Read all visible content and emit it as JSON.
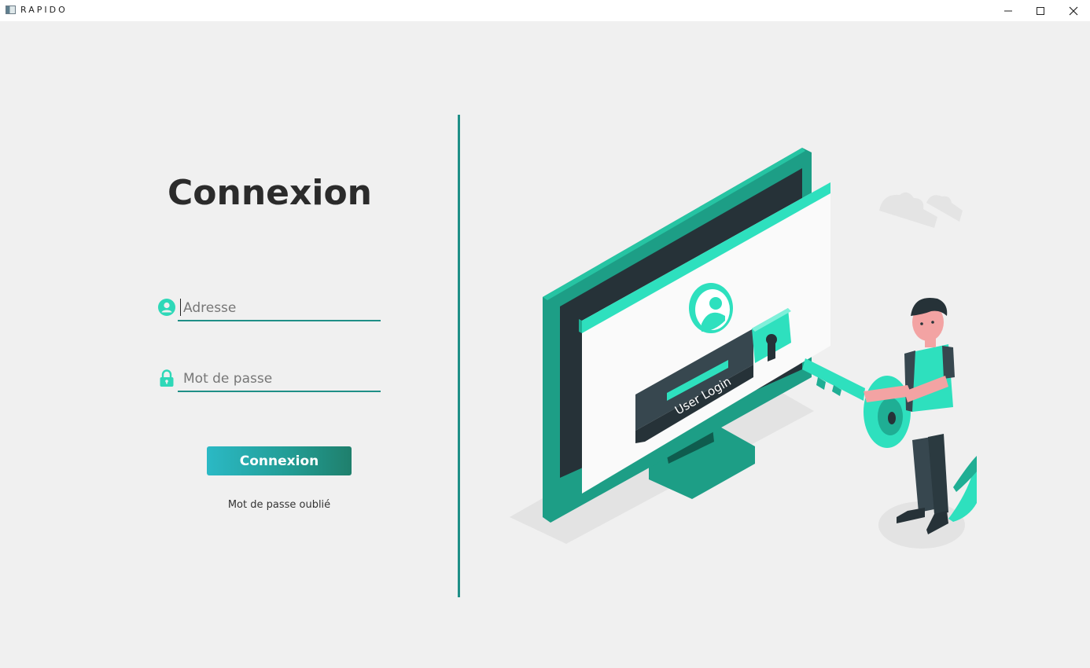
{
  "window": {
    "title": "RAPIDO",
    "controls": {
      "minimize": "–",
      "maximize": "☐",
      "close": "✕"
    }
  },
  "login": {
    "heading": "Connexion",
    "address": {
      "value": "",
      "placeholder": "Adresse",
      "icon": "user-circle-icon"
    },
    "password": {
      "value": "",
      "placeholder": "Mot de passe",
      "icon": "lock-icon"
    },
    "submit_label": "Connexion",
    "forgot_label": "Mot de passe oublié"
  },
  "illustration": {
    "screen_text": "User Login"
  },
  "colors": {
    "accent": "#1f8f87",
    "mint": "#2ee0be",
    "dark": "#263238",
    "background": "#f0f0f0"
  }
}
